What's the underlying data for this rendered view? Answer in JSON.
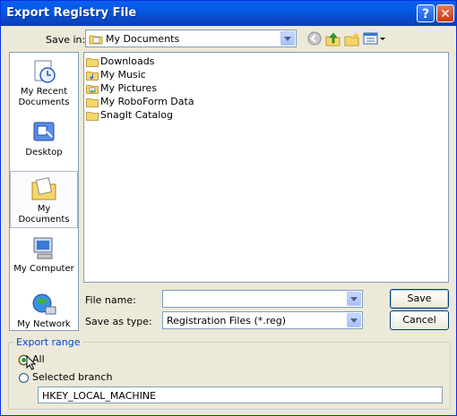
{
  "window": {
    "title": "Export Registry File",
    "help_glyph": "?",
    "close_glyph": "✕"
  },
  "save_in": {
    "label": "Save in:",
    "value": "My Documents"
  },
  "toolbar": {
    "icons": [
      "back-icon",
      "up-folder-icon",
      "new-folder-icon",
      "views-menu-icon"
    ]
  },
  "places": [
    {
      "label": "My Recent Documents",
      "icon": "recent-documents-icon"
    },
    {
      "label": "Desktop",
      "icon": "desktop-icon"
    },
    {
      "label": "My Documents",
      "icon": "my-documents-icon",
      "selected": true
    },
    {
      "label": "My Computer",
      "icon": "my-computer-icon"
    },
    {
      "label": "My Network",
      "icon": "my-network-icon"
    }
  ],
  "files": [
    "Downloads",
    "My Music",
    "My Pictures",
    "My RoboForm Data",
    "SnagIt Catalog"
  ],
  "file_name": {
    "label": "File name:",
    "value": ""
  },
  "save_as_type": {
    "label": "Save as type:",
    "value": "Registration Files (*.reg)"
  },
  "buttons": {
    "save": "Save",
    "cancel": "Cancel"
  },
  "export_range": {
    "legend": "Export range",
    "all_label": "All",
    "selected_branch_label": "Selected branch",
    "selected": "All",
    "branch_value": "HKEY_LOCAL_MACHINE"
  },
  "colors": {
    "title_bar": "#0a5ff0",
    "dialog_bg": "#ece9d8",
    "legend_text": "#0046d5"
  }
}
